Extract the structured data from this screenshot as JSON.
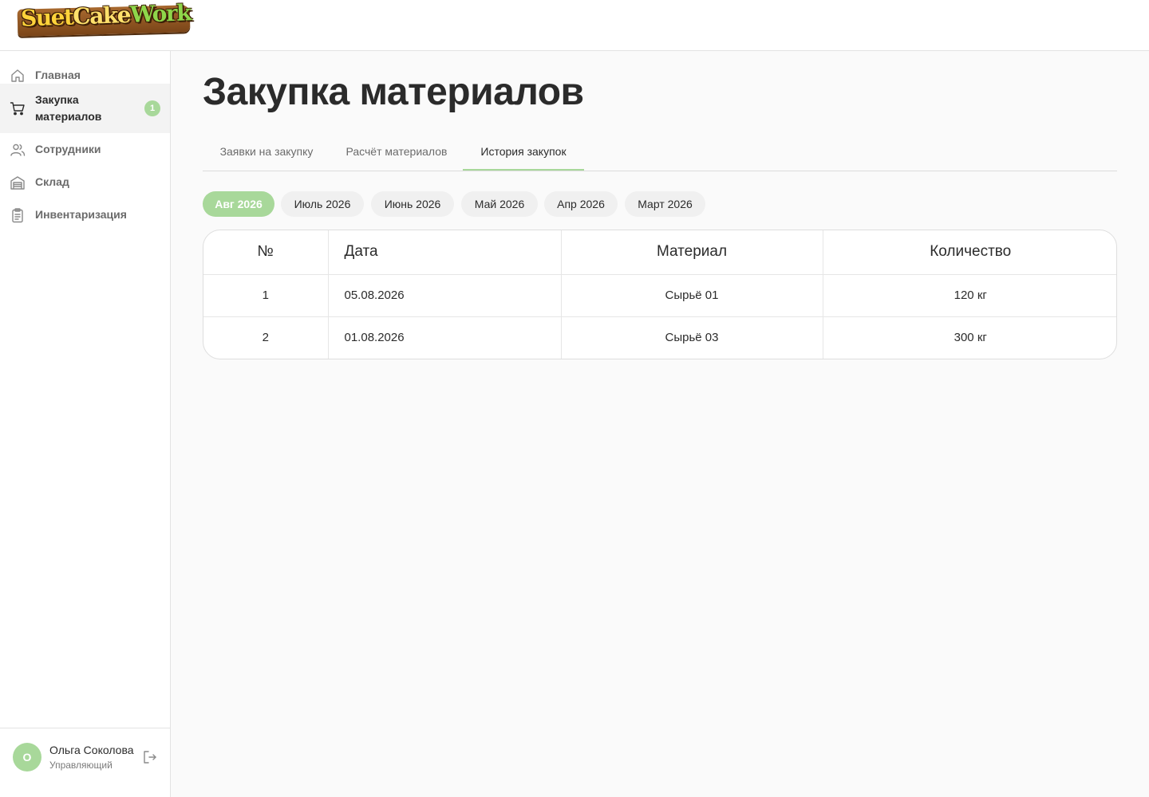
{
  "app": {
    "logo_text": "Suet Cake Work",
    "logo_parts": [
      "Suet",
      "Cake",
      "Work"
    ]
  },
  "sidebar": {
    "items": [
      {
        "label": "Главная",
        "icon": "home-icon",
        "active": false
      },
      {
        "label": "Закупка материалов",
        "icon": "cart-icon",
        "active": true,
        "badge": "1"
      },
      {
        "label": "Сотрудники",
        "icon": "users-icon",
        "active": false
      },
      {
        "label": "Склад",
        "icon": "warehouse-icon",
        "active": false
      },
      {
        "label": "Инвентаризация",
        "icon": "clipboard-icon",
        "active": false
      }
    ],
    "user": {
      "initial": "О",
      "name": "Ольга Соколова",
      "role": "Управляющий",
      "logout_icon": "logout-icon"
    }
  },
  "main": {
    "title": "Закупка материалов",
    "tabs": [
      {
        "label": "Заявки на закупку",
        "active": false
      },
      {
        "label": "Расчёт материалов",
        "active": false
      },
      {
        "label": "История закупок",
        "active": true
      }
    ],
    "months": [
      {
        "label": "Авг 2026",
        "active": true
      },
      {
        "label": "Июль 2026",
        "active": false
      },
      {
        "label": "Июнь 2026",
        "active": false
      },
      {
        "label": "Май 2026",
        "active": false
      },
      {
        "label": "Апр 2026",
        "active": false
      },
      {
        "label": "Март 2026",
        "active": false
      }
    ],
    "table": {
      "columns": [
        "№",
        "Дата",
        "Материал",
        "Количество"
      ],
      "rows": [
        [
          "1",
          "05.08.2026",
          "Сырьё 01",
          "120 кг"
        ],
        [
          "2",
          "01.08.2026",
          "Сырьё 03",
          "300 кг"
        ]
      ]
    }
  },
  "colors": {
    "accent": "#a8d89a",
    "text": "#2b2b2b",
    "muted": "#6b6b6b",
    "background": "#fafafa"
  }
}
